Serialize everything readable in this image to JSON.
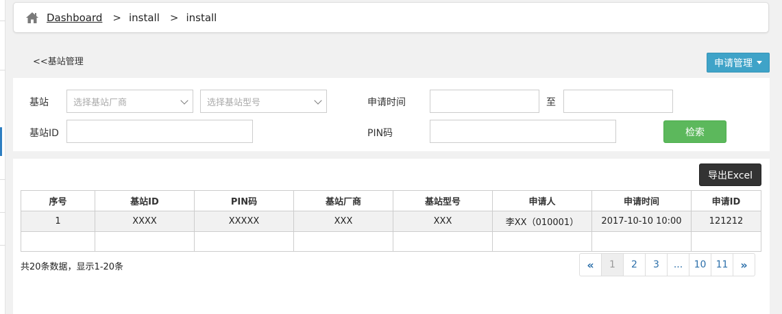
{
  "breadcrumb": {
    "home_icon": "home-icon",
    "root": "Dashboard",
    "separator": ">",
    "items": [
      "install",
      "install"
    ]
  },
  "back_link": "<<基站管理",
  "apply_menu": {
    "label": "申请管理"
  },
  "filters": {
    "station_label": "基站",
    "vendor_placeholder": "选择基站厂商",
    "model_placeholder": "选择基站型号",
    "apply_time_label": "申请时间",
    "to_label": "至",
    "station_id_label": "基站ID",
    "pin_label": "PIN码",
    "search_label": "检索"
  },
  "export_label": "导出Excel",
  "table": {
    "columns": [
      "序号",
      "基站ID",
      "PIN码",
      "基站厂商",
      "基站型号",
      "申请人",
      "申请时间",
      "申请ID"
    ],
    "rows": [
      [
        "1",
        "XXXX",
        "XXXXX",
        "XXX",
        "XXX",
        "李XX（010001）",
        "2017-10-10 10:00",
        "121212"
      ]
    ]
  },
  "summary": "共20条数据，显示1-20条",
  "pagination": {
    "prev": "«",
    "pages": [
      "1",
      "2",
      "3",
      "...",
      "10",
      "11"
    ],
    "current": "1",
    "next": "»"
  },
  "colors": {
    "primary": "#3fa3c8",
    "success": "#5cb85c",
    "dark": "#333333",
    "link": "#2a6ea9"
  }
}
